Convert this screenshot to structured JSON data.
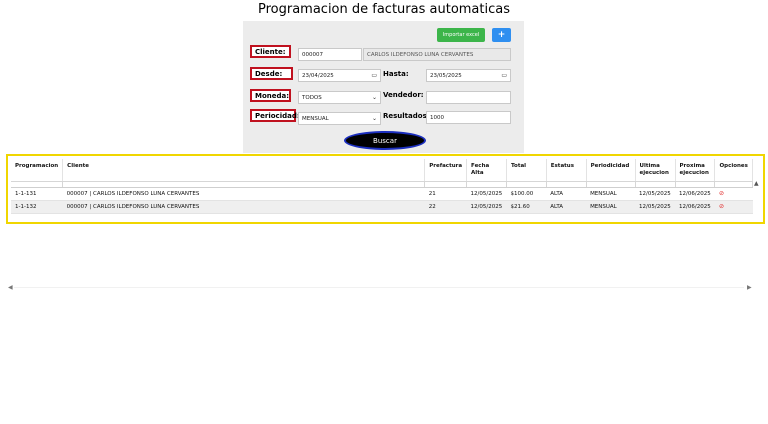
{
  "page": {
    "title": "Programacion de facturas automaticas"
  },
  "toolbar": {
    "import_label": "Importar excel",
    "add_label": "+"
  },
  "form": {
    "cliente_label": "Cliente:",
    "cliente_code": "000007",
    "cliente_name": "CARLOS ILDEFONSO LUNA CERVANTES",
    "desde_label": "Desde:",
    "desde_value": "23/04/2025",
    "hasta_label": "Hasta:",
    "hasta_value": "23/05/2025",
    "moneda_label": "Moneda:",
    "moneda_value": "TODOS",
    "vendedor_label": "Vendedor:",
    "vendedor_value": "",
    "periodicidad_label": "Periocidad:",
    "periodicidad_value": "MENSUAL",
    "resultados_label": "Resultados:",
    "resultados_value": "1000",
    "search_label": "Buscar"
  },
  "table": {
    "headers": [
      "Programacion",
      "Cliente",
      "Prefactura",
      "Fecha Alta",
      "Total",
      "Estatus",
      "Periodicidad",
      "Ultima ejecucion",
      "Proxima ejecucion",
      "Opciones"
    ],
    "rows": [
      [
        "1-1-131",
        "000007 | CARLOS ILDEFONSO LUNA CERVANTES",
        "21",
        "12/05/2025",
        "$100.00",
        "ALTA",
        "MENSUAL",
        "12/05/2025",
        "12/06/2025"
      ],
      [
        "1-1-132",
        "000007 | CARLOS ILDEFONSO LUNA CERVANTES",
        "22",
        "12/05/2025",
        "$21.60",
        "ALTA",
        "MENSUAL",
        "12/05/2025",
        "12/06/2025"
      ]
    ]
  },
  "icons": {
    "option_icon": "cancel-icon",
    "option_color": "#e02b2b"
  },
  "colors": {
    "import_btn": "#3cb54a",
    "add_btn": "#2f8ff0",
    "label_border": "#c0111f",
    "table_frame": "#f0d600"
  }
}
